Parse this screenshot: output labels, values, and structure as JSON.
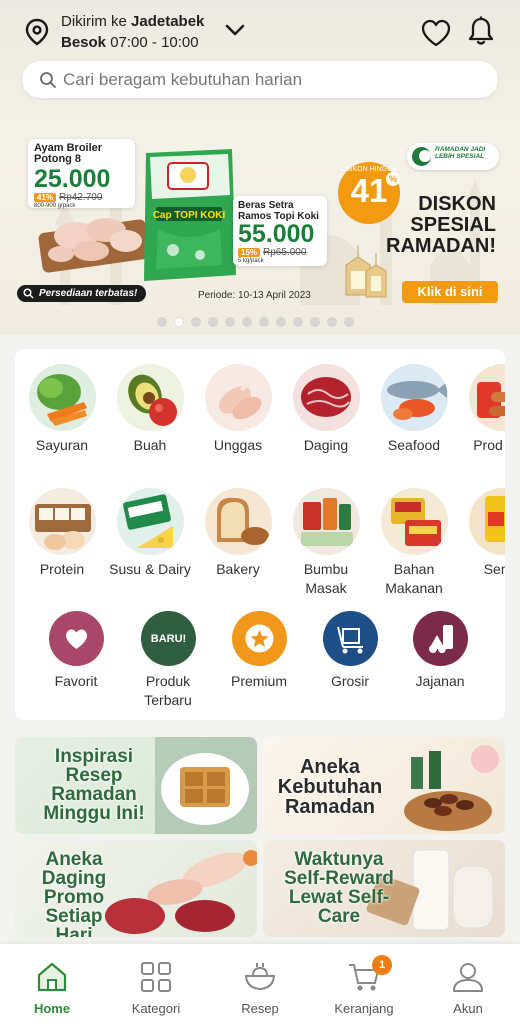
{
  "header": {
    "delivery_prefix": "Dikirim ke",
    "delivery_area": "Jadetabek",
    "delivery_day": "Besok",
    "delivery_time": "07:00 - 10:00",
    "search_placeholder": "Cari beragam kebutuhan harian"
  },
  "banner": {
    "product1": {
      "name": "Ayam Broiler Potong 8",
      "price": "25.000",
      "discount": "41%",
      "old_price": "Rp42.700",
      "unit": "800-900 g/pack"
    },
    "product2": {
      "name": "Beras Setra Ramos Topi Koki",
      "price": "55.000",
      "discount": "15%",
      "old_price": "Rp65.000",
      "unit": "5 kg/pack"
    },
    "rice_bag_label": "Cap TOPI KOKI",
    "discount_prefix": "DISKON HINGGA",
    "discount_value": "41",
    "discount_unit": "%",
    "ramadan_badge": "RAMADAN JADI LEBIH SPESIAL",
    "headline": "DISKON SPESIAL RAMADAN!",
    "limited_stock": "Persediaan terbatas!",
    "period": "Periode: 10-13 April 2023",
    "cta": "Klik di sini",
    "page_count": 12,
    "active_page": 2
  },
  "categories": [
    {
      "label": "Sayuran",
      "icon": "vegetables-icon"
    },
    {
      "label": "Buah",
      "icon": "fruit-icon"
    },
    {
      "label": "Unggas",
      "icon": "poultry-icon"
    },
    {
      "label": "Daging",
      "icon": "meat-icon"
    },
    {
      "label": "Seafood",
      "icon": "seafood-icon"
    },
    {
      "label": "Prod Bek",
      "icon": "frozen-product-icon"
    },
    {
      "label": "Protein",
      "icon": "protein-icon"
    },
    {
      "label": "Susu & Dairy",
      "icon": "dairy-icon"
    },
    {
      "label": "Bakery",
      "icon": "bakery-icon"
    },
    {
      "label": "Bumbu Masak",
      "icon": "spices-icon"
    },
    {
      "label": "Bahan Makanan",
      "icon": "food-ingredients-icon"
    },
    {
      "label": "Semb",
      "icon": "staples-icon"
    }
  ],
  "quick_links": [
    {
      "label": "Favorit",
      "icon": "heart-icon",
      "color": "#a8476a"
    },
    {
      "label": "Produk Terbaru",
      "icon": "new-badge-icon",
      "badge_text": "BARU!",
      "color": "#2f5f40"
    },
    {
      "label": "Premium",
      "icon": "star-icon",
      "color": "#f1971a"
    },
    {
      "label": "Grosir",
      "icon": "trolley-icon",
      "color": "#1d4f86"
    },
    {
      "label": "Jajanan",
      "icon": "snack-icon",
      "color": "#7b2a4a"
    }
  ],
  "promo_tiles": [
    {
      "title": "Inspirasi Resep Ramadan Minggu Ini!"
    },
    {
      "title": "Aneka Kebutuhan Ramadan"
    },
    {
      "title": "Aneka Daging Promo Setiap Hari"
    },
    {
      "title": "Waktunya Self-Reward Lewat Self-Care"
    }
  ],
  "bottom_nav": [
    {
      "label": "Home",
      "icon": "home-icon",
      "active": true
    },
    {
      "label": "Kategori",
      "icon": "grid-icon",
      "active": false
    },
    {
      "label": "Resep",
      "icon": "recipe-bowl-icon",
      "active": false
    },
    {
      "label": "Keranjang",
      "icon": "cart-icon",
      "active": false,
      "badge": "1"
    },
    {
      "label": "Akun",
      "icon": "account-icon",
      "active": false
    }
  ],
  "colors": {
    "brand_green": "#2e8b3c",
    "accent_orange": "#f29a10"
  }
}
